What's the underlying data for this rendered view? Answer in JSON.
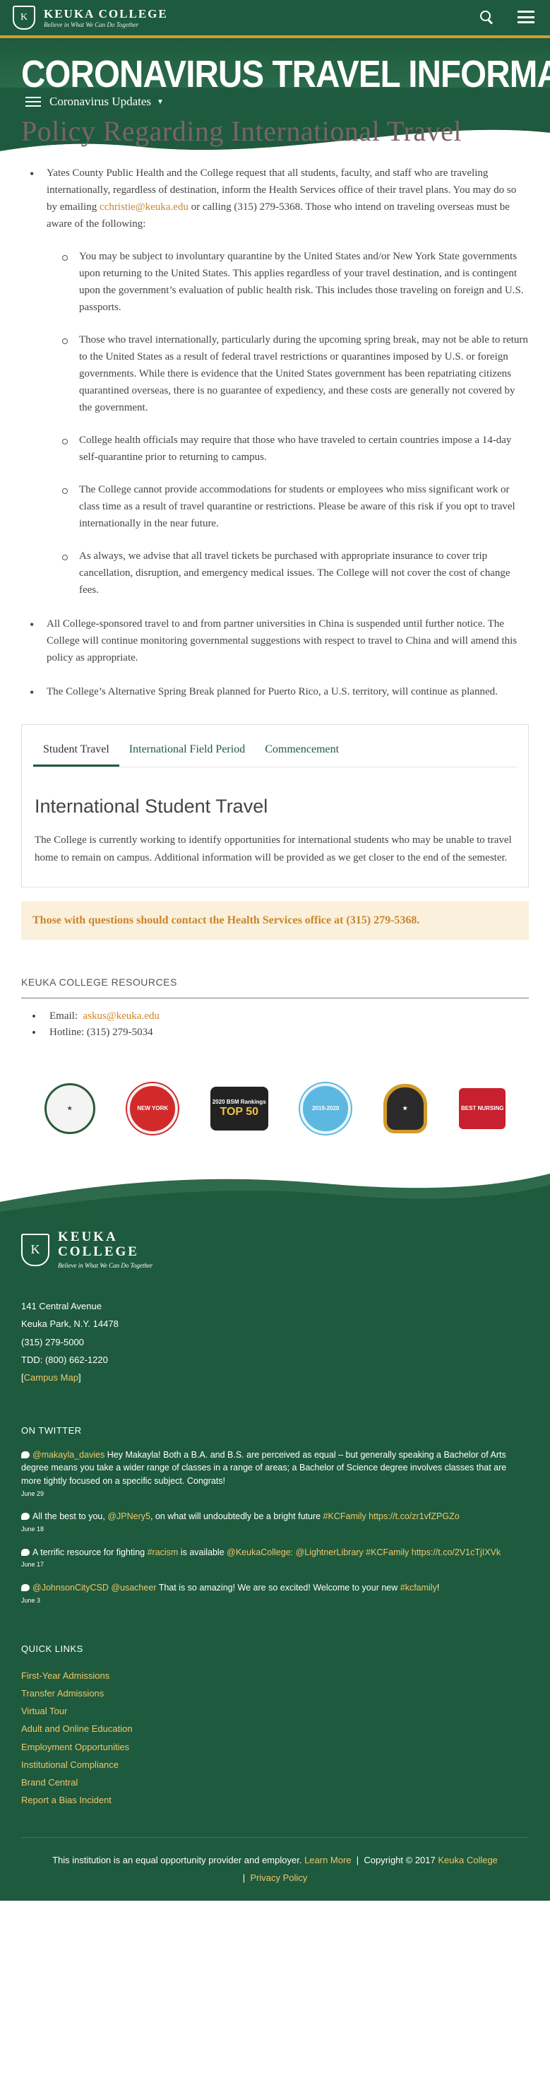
{
  "header": {
    "brand_name": "KEUKA COLLEGE",
    "brand_tagline": "Believe in What We Can Do Together",
    "logo_letter": "K"
  },
  "hero": {
    "title": "CORONAVIRUS TRAVEL INFORMATION",
    "subnav_label": "Coronavirus Updates"
  },
  "main": {
    "title": "Policy Regarding International Travel",
    "p1_before": "Yates County Public Health and the College request that all students, faculty, and staff who are traveling internationally, regardless of destination, inform the Health Services office of their travel plans. You may do so by emailing ",
    "p1_email": "cchristie@keuka.edu",
    "p1_after": " or calling (315) 279-5368. Those who intend on traveling overseas must be aware of the following:",
    "subitems": [
      "You may be subject to involuntary quarantine by the United States and/or New York State governments upon returning to the United States. This applies regardless of your travel destination, and is contingent upon the government’s evaluation of public health risk. This includes those traveling on foreign and U.S. passports.",
      "Those who travel internationally, particularly during the upcoming spring break, may not be able to return to the United States as a result of federal travel restrictions or quarantines imposed by U.S. or foreign governments. While there is evidence that the United States government has been repatriating citizens quarantined overseas, there is no guarantee of expediency, and these costs are generally not covered by the government.",
      "College health officials may require that those who have traveled to certain countries impose a 14-day self-quarantine prior to returning to campus.",
      "The College cannot provide accommodations for students or employees who miss significant work or class time as a result of travel quarantine or restrictions. Please be aware of this risk if you opt to travel internationally in the near future.",
      "As always, we advise that all travel tickets be purchased with appropriate insurance to cover trip cancellation, disruption, and emergency medical issues. The College will not cover the cost of change fees."
    ],
    "item2": "All College-sponsored travel to and from partner universities in China is suspended until further notice. The College will continue monitoring governmental suggestions with respect to travel to China and will amend this policy as appropriate.",
    "item3": "The College’s Alternative Spring Break planned for Puerto Rico, a U.S. territory, will continue as planned."
  },
  "tabs": {
    "items": [
      "Student Travel",
      "International Field Period",
      "Commencement"
    ],
    "panel_title": "International Student Travel",
    "panel_text": "The College is currently working to identify opportunities for international students who may be unable to travel home to remain on campus. Additional information will be provided as we get closer to the end of the semester."
  },
  "notice": "Those with questions should contact the Health Services office at (315) 279-5368.",
  "resources": {
    "title": "KEUKA COLLEGE RESOURCES",
    "email_label": "Email:",
    "email": "askus@keuka.edu",
    "hotline": "Hotline: (315) 279-5034"
  },
  "badges": {
    "b2": "NEW YORK",
    "b3_top": "2020 BSM Rankings",
    "b3_main": "TOP 50",
    "b4": "2019-2020",
    "b6": "BEST NURSING"
  },
  "footer": {
    "name_line1": "KEUKA",
    "name_line2": "COLLEGE",
    "tagline": "Believe in What We Can Do Together",
    "address1": "141 Central Avenue",
    "address2": "Keuka Park, N.Y. 14478",
    "phone": "(315) 279-5000",
    "tdd": "TDD: (800) 662-1220",
    "campus_map": "Campus Map",
    "twitter_title": "ON TWITTER",
    "tweets": [
      {
        "handle": "@makayla_davies",
        "text": " Hey Makayla! Both a B.A. and B.S. are perceived as equal – but generally speaking a Bachelor of Arts degree means you take a wider range of classes in a range of areas; a Bachelor of Science degree involves classes that are more tightly focused on a specific subject. Congrats!",
        "date": "June 29"
      },
      {
        "handle": "@JPNery5",
        "pre": "All the best to you, ",
        "text": ", on what will undoubtedly be a bright future ",
        "tag": "#KCFamily https://t.co/zr1vfZPGZo",
        "date": "June 18"
      },
      {
        "pre": "A terrific resource for fighting ",
        "handle": "#racism",
        "text": " is available ",
        "tag": "@KeukaCollege: @LightnerLibrary #KCFamily https://t.co/2V1cTjIXVk",
        "date": "June 17"
      },
      {
        "handle": "@JohnsonCityCSD @usacheer",
        "text": " That is so amazing! We are so excited! Welcome to your new ",
        "tag": "#kcfamily",
        "end": "!",
        "date": "June 3"
      }
    ],
    "quick_title": "QUICK LINKS",
    "quick_links": [
      "First-Year Admissions",
      "Transfer Admissions",
      "Virtual Tour",
      "Adult and Online Education",
      "Employment Opportunities",
      "Institutional Compliance",
      "Brand Central",
      "Report a Bias Incident"
    ],
    "eo_text": "This institution is an equal opportunity provider and employer.",
    "learn_more": "Learn More",
    "copyright": "Copyright © 2017",
    "copyright_link": "Keuka College",
    "privacy": "Privacy Policy"
  },
  "colors": {
    "brand_green": "#1e5a3d",
    "accent_gold": "#d39b2a",
    "title_mauve": "#7a6468"
  }
}
